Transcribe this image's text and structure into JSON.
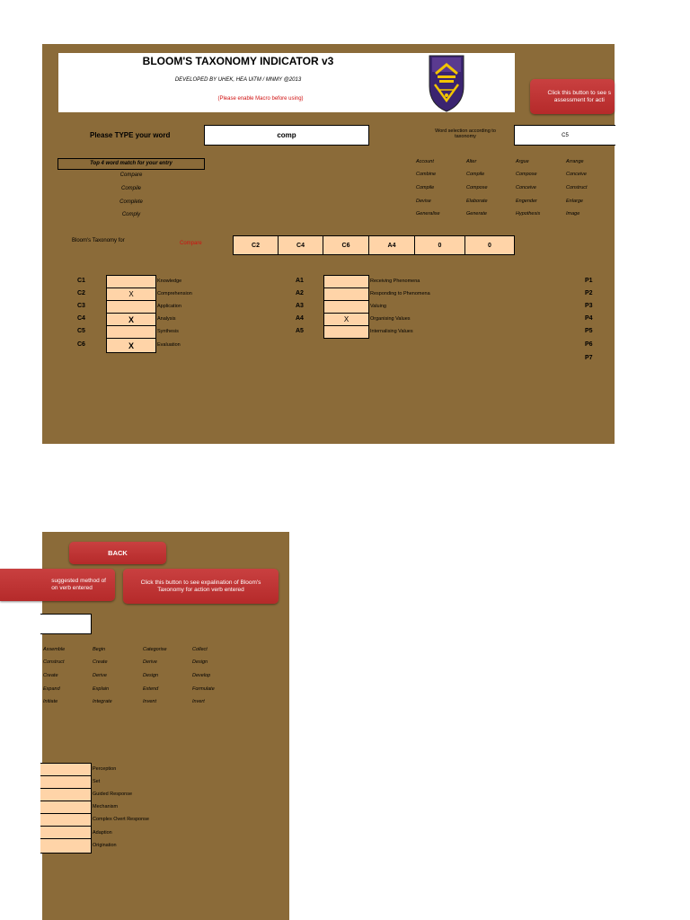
{
  "header": {
    "title": "BLOOM'S TAXONOMY INDICATOR v3",
    "developed_by": "DEVELOPED BY UHEK, HEA UiTM / MNMY @2013",
    "macro_note": "(Please enable Macro before using)"
  },
  "assessment_button_top": {
    "line1": "Click this button to see s",
    "line2": "assessment for acti"
  },
  "input": {
    "label": "Please TYPE your word",
    "value": "comp",
    "selection_label": "Word selection according to taxonomy",
    "selection_value": "C5"
  },
  "matches": {
    "heading": "Top 4 word match for your entry",
    "items": [
      "Compare",
      "Compile",
      "Complete",
      "Comply"
    ]
  },
  "verbs_top": [
    [
      "Account",
      "Alter",
      "Argue",
      "Arrange"
    ],
    [
      "Combine",
      "Compile",
      "Compose",
      "Conceive"
    ],
    [
      "Compile",
      "Compose",
      "Conceive",
      "Construct"
    ],
    [
      "Devise",
      "Elaborate",
      "Engender",
      "Enlarge"
    ],
    [
      "Generalise",
      "Generate",
      "Hypothesis",
      "Image"
    ]
  ],
  "bloom_for": {
    "label": "Bloom's Taxonomy for",
    "word": "Compare",
    "cells": [
      "C2",
      "C4",
      "C6",
      "A4",
      "0",
      "0"
    ]
  },
  "cognitive": [
    {
      "code": "C1",
      "mark": "",
      "name": "Knowledge"
    },
    {
      "code": "C2",
      "mark": "X",
      "name": "Comprehension"
    },
    {
      "code": "C3",
      "mark": "",
      "name": "Application"
    },
    {
      "code": "C4",
      "mark": "X",
      "name": "Analysis"
    },
    {
      "code": "C5",
      "mark": "",
      "name": "Synthesis"
    },
    {
      "code": "C6",
      "mark": "X",
      "name": "Evaluation"
    }
  ],
  "affective": [
    {
      "code": "A1",
      "mark": "",
      "name": "Receiving Phenomena"
    },
    {
      "code": "A2",
      "mark": "",
      "name": "Responding to Phenomena"
    },
    {
      "code": "A3",
      "mark": "",
      "name": "Valuing"
    },
    {
      "code": "A4",
      "mark": "X",
      "name": "Organising Values"
    },
    {
      "code": "A5",
      "mark": "",
      "name": "Internalising Values"
    }
  ],
  "psychomotor_codes": [
    "P1",
    "P2",
    "P3",
    "P4",
    "P5",
    "P6",
    "P7"
  ],
  "bottom": {
    "back_label": "BACK",
    "method_button": {
      "line1": "suggested method of",
      "line2": "on verb entered"
    },
    "explain_button": {
      "line1": "Click this button to see expalination of Bloom's",
      "line2": "Taxonomy for action verb entered"
    },
    "verbs": [
      [
        "Assemble",
        "Begin",
        "Categorise",
        "Collect"
      ],
      [
        "Construct",
        "Create",
        "Derive",
        "Design"
      ],
      [
        "Create",
        "Derive",
        "Design",
        "Develop"
      ],
      [
        "Expand",
        "Explain",
        "Extend",
        "Formulate"
      ],
      [
        "Initiate",
        "Integrate",
        "Invent",
        "Invert"
      ]
    ],
    "psychomotor_levels": [
      "Perception",
      "Set",
      "Guided Response",
      "Mechanism",
      "Complex Overt Response",
      "Adaption",
      "Origination"
    ]
  }
}
